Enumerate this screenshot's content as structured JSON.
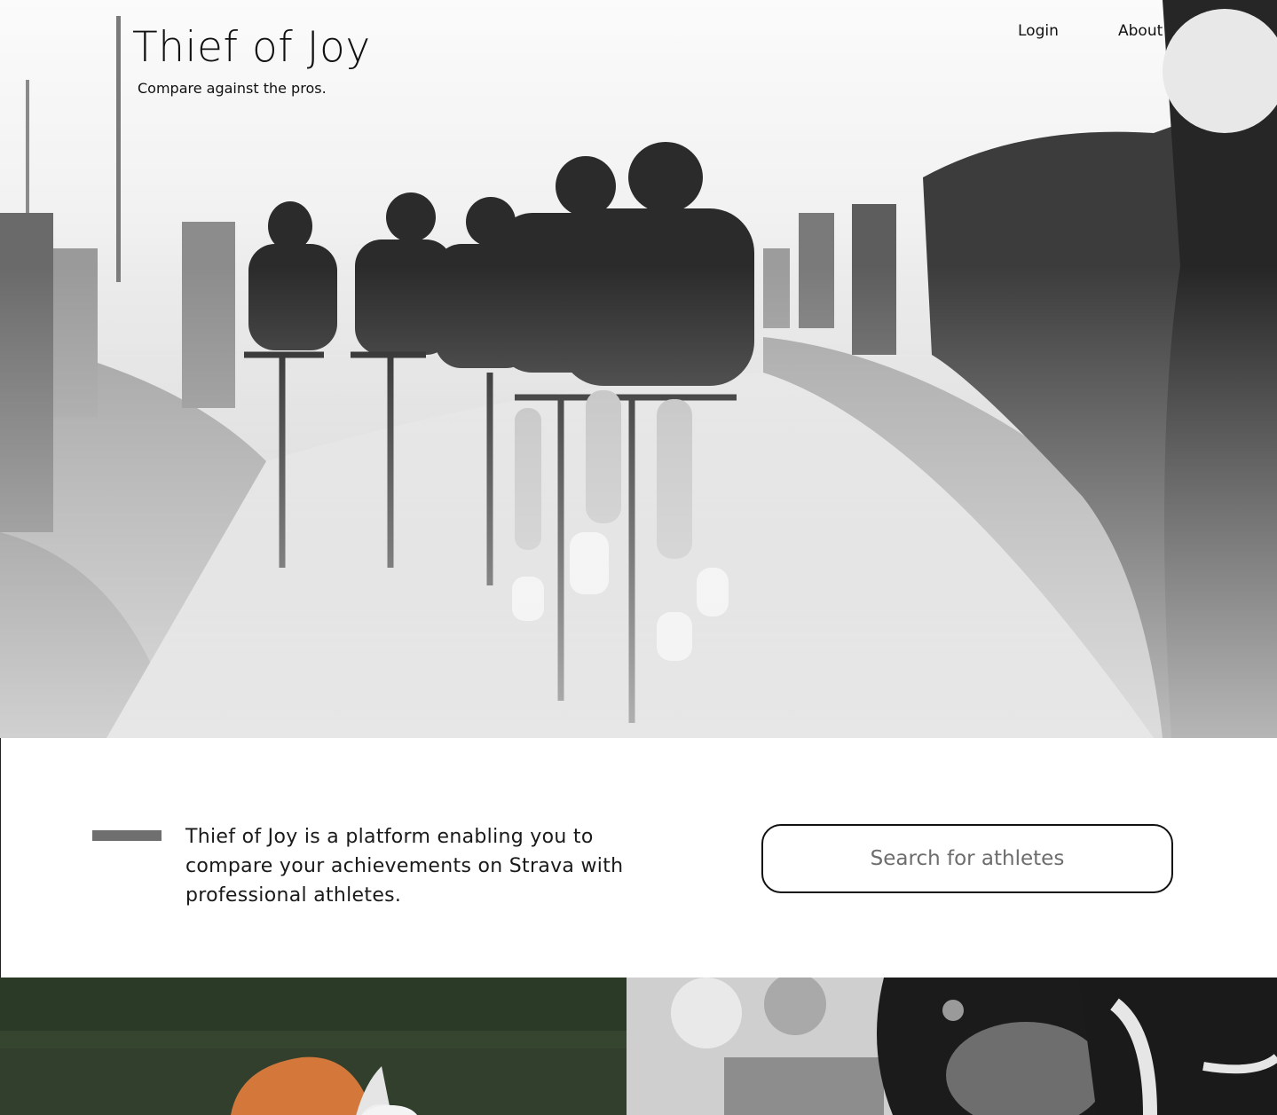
{
  "header": {
    "title": "Thief of Joy",
    "tagline": "Compare against the pros.",
    "nav": [
      {
        "label": "Login"
      },
      {
        "label": "About"
      }
    ]
  },
  "hero": {
    "image": "cyclists-racing-on-cobbled-road-grayscale"
  },
  "intro": {
    "text": "Thief of Joy is a platform enabling you to compare your achievements on Strava with professional athletes."
  },
  "search": {
    "placeholder": "Search for athletes",
    "value": ""
  },
  "gallery": {
    "cards": [
      {
        "image": "cyclist-in-orange-jersey"
      },
      {
        "image": "cyclist-close-up-grayscale"
      }
    ]
  },
  "colors": {
    "accent_rule": "#6f6f6f",
    "text": "#111111",
    "background": "#ffffff"
  }
}
